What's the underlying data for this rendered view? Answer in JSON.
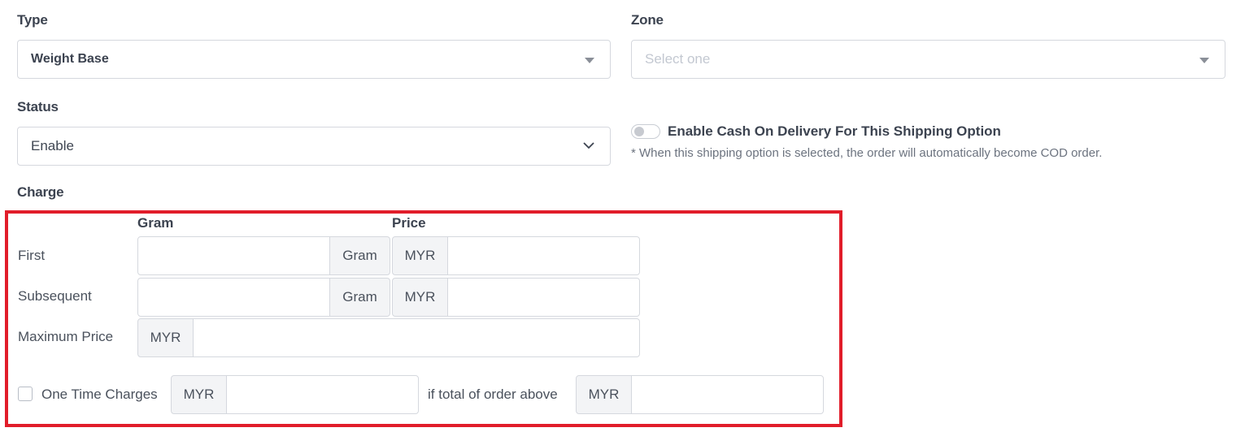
{
  "type": {
    "label": "Type",
    "value": "Weight Base"
  },
  "zone": {
    "label": "Zone",
    "placeholder": "Select one"
  },
  "status": {
    "label": "Status",
    "value": "Enable"
  },
  "cod": {
    "enabled": false,
    "title": "Enable Cash On Delivery For This Shipping Option",
    "note": "* When this shipping option is selected, the order will automatically become COD order."
  },
  "charge": {
    "label": "Charge",
    "headers": {
      "gram": "Gram",
      "price": "Price"
    },
    "rows": [
      {
        "label": "First",
        "gram_value": "",
        "gram_unit": "Gram",
        "currency": "MYR",
        "price_value": ""
      },
      {
        "label": "Subsequent",
        "gram_value": "",
        "gram_unit": "Gram",
        "currency": "MYR",
        "price_value": ""
      }
    ],
    "maximum_price": {
      "label": "Maximum Price",
      "currency": "MYR",
      "value": ""
    },
    "one_time": {
      "checked": false,
      "label": "One Time Charges",
      "currency": "MYR",
      "value": "",
      "condition_label": "if total of order above",
      "condition_currency": "MYR",
      "condition_value": ""
    }
  },
  "colors": {
    "highlight": "#e11d2a",
    "addon_bg": "#f3f4f6",
    "border": "#d5d8de"
  }
}
